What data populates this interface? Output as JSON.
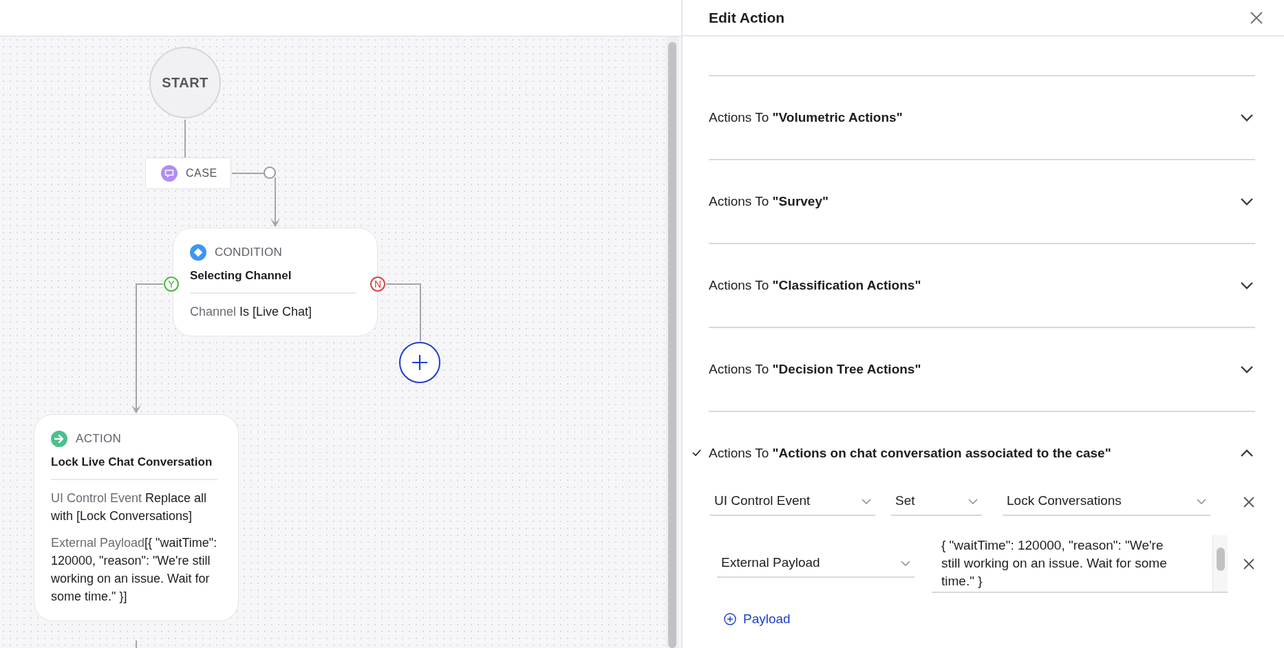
{
  "canvas": {
    "nodes": [
      {
        "kind": "start",
        "label": "START"
      },
      {
        "kind": "trigger",
        "label": "CASE"
      },
      {
        "kind": "condition",
        "type_label": "CONDITION",
        "title": "Selecting Channel",
        "details": [
          {
            "label": "Channel",
            "value": " Is [Live Chat]"
          }
        ],
        "yes_label": "Y",
        "no_label": "N"
      },
      {
        "kind": "add"
      },
      {
        "kind": "action",
        "type_label": "ACTION",
        "title": "Lock Live Chat Conversation",
        "details": [
          {
            "label": "UI Control Event",
            "value": " Replace all with [Lock Conversations]"
          },
          {
            "label": "External Payload",
            "value": "[{ \"waitTime\": 120000, \"reason\": \"We're still working on an issue. Wait for some time.\" }]"
          }
        ]
      }
    ]
  },
  "panel": {
    "title": "Edit Action",
    "sections": [
      {
        "label": "Actions To **\"Volumetric Actions\"**",
        "expanded": false,
        "checked": false
      },
      {
        "label": "Actions To **\"Survey\"**",
        "expanded": false,
        "checked": false
      },
      {
        "label": "Actions To **\"Classification Actions\"**",
        "expanded": false,
        "checked": false
      },
      {
        "label": "Actions To **\"Decision Tree Actions\"**",
        "expanded": false,
        "checked": false
      },
      {
        "label": "Actions To **\"Actions on chat conversation associated to the case\"**",
        "expanded": true,
        "checked": true,
        "rows": [
          {
            "kind": "select-row",
            "fields": [
              "UI Control Event",
              "Set",
              "Lock Conversations"
            ]
          },
          {
            "kind": "payload-row",
            "key": "External Payload",
            "value": "{ \"waitTime\": 120000, \"reason\": \"We're still working on an issue. Wait for some time.\" }"
          }
        ],
        "add_link": "Payload"
      }
    ]
  }
}
